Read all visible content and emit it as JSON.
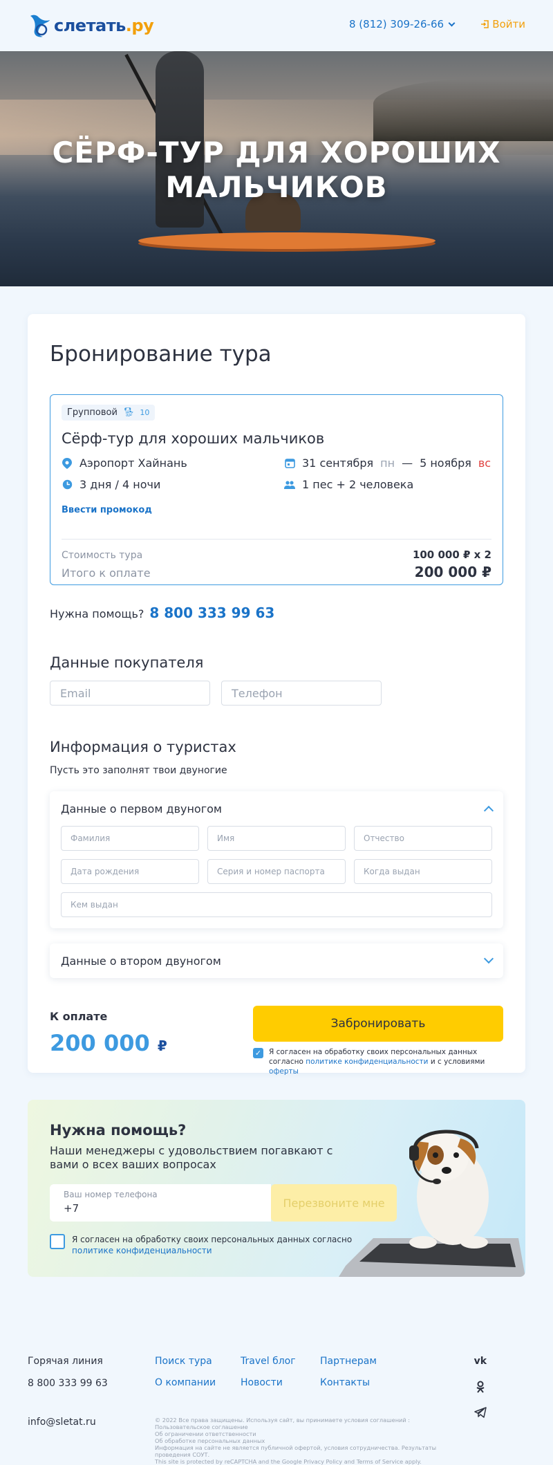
{
  "header": {
    "logo_main": "слетать",
    "logo_suffix": ".ру",
    "phone": "8 (812) 309-26-66",
    "login": "Войти",
    "login_icon": "login-arrow-icon"
  },
  "hero": {
    "title_line1": "СЁРФ-ТУР ДЛЯ ХОРОШИХ",
    "title_line2": "МАЛЬЧИКОВ"
  },
  "booking": {
    "title": "Бронирование тура",
    "tour": {
      "type_badge": "Групповой",
      "badge_count": "10",
      "name": "Сёрф-тур для хороших мальчиков",
      "airport": "Аэропорт Хайнань",
      "date_from": "31 сентября",
      "date_from_day": "пн",
      "date_dash": "—",
      "date_to": "5 ноября",
      "date_to_day": "вс",
      "duration": "3 дня / 4 ночи",
      "travelers": "1 пес + 2 человека",
      "promo_link": "Ввести промокод",
      "cost_label": "Стоимость тура",
      "cost_value": "100 000 ₽ x 2",
      "total_label": "Итого к оплате",
      "total_value": "200 000 ₽"
    },
    "help_label": "Нужна помощь?",
    "help_phone": "8 800 333 99 63",
    "buyer": {
      "title": "Данные покупателя",
      "email_placeholder": "Email",
      "phone_placeholder": "Телефон"
    },
    "tourists": {
      "title": "Информация о туристах",
      "subtitle": "Пусть это заполнят твои двуногие",
      "first": {
        "title": "Данные о первом двуногом",
        "surname": "Фамилия",
        "name": "Имя",
        "patronymic": "Отчество",
        "birth": "Дата рождения",
        "passport": "Серия и номер паспорта",
        "issued_date": "Когда выдан",
        "issued_by": "Кем выдан"
      },
      "second": {
        "title": "Данные о втором двуногом"
      }
    },
    "payment": {
      "label": "К оплате",
      "amount": "200 000",
      "currency": "₽",
      "button": "Забронировать",
      "agree_text": "Я согласен на обработку своих персональных данных согласно",
      "agree_link1": "политике конфиденциальности",
      "agree_mid": "и с условиями",
      "agree_link2": "оферты"
    }
  },
  "help_panel": {
    "title": "Нужна помощь?",
    "lead": "Наши менеджеры с удовольствием погавкают с вами о всех ваших вопросах",
    "phone_label": "Ваш номер телефона",
    "phone_value": "+7",
    "call_button": "Перезвоните мне",
    "agree_text": "Я согласен на обработку своих персональных данных согласно",
    "agree_link": "политике конфиденциальности"
  },
  "footer": {
    "hotline_label": "Горячая линия",
    "hotline_phone": "8 800 333 99 63",
    "email": "info@sletat.ru",
    "links": [
      "Поиск тура",
      "Travel блог",
      "Партнерам",
      "О компании",
      "Новости",
      "Контакты"
    ],
    "social": [
      "vk-icon",
      "ok-icon",
      "telegram-icon"
    ],
    "legal": [
      "© 2022 Все права защищены. Используя сайт, вы принимаете условия соглашений :",
      "Пользовательское соглашение",
      "Об ограничении ответственности",
      "Об обработке персональных данных",
      "Информация на сайте не является публичной офертой, условия сотрудничества. Результаты проведения СОУТ.",
      "This site is protected by reCAPTCHA and the Google Privacy Policy and Terms of Service apply."
    ]
  },
  "colors": {
    "accent": "#3d9ae0",
    "link": "#1a73c8",
    "cta": "#ffcc00",
    "brand_orange": "#f2a00c"
  }
}
